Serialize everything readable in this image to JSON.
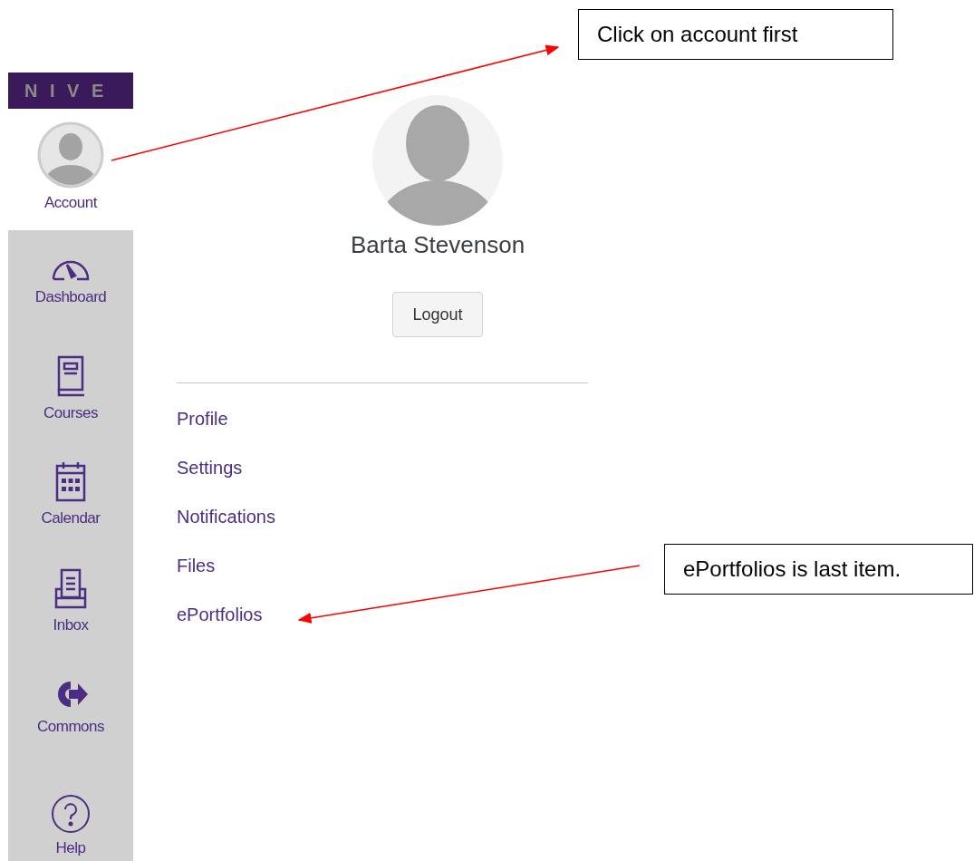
{
  "brand": {
    "text": "N I V E"
  },
  "sidebar": {
    "items": [
      {
        "label": "Account",
        "kind": "account",
        "selected": true
      },
      {
        "label": "Dashboard",
        "kind": "dashboard",
        "selected": false
      },
      {
        "label": "Courses",
        "kind": "courses",
        "selected": false
      },
      {
        "label": "Calendar",
        "kind": "calendar",
        "selected": false
      },
      {
        "label": "Inbox",
        "kind": "inbox",
        "selected": false
      },
      {
        "label": "Commons",
        "kind": "commons",
        "selected": false
      },
      {
        "label": "Help",
        "kind": "help",
        "selected": false
      }
    ]
  },
  "account": {
    "name": "Barta Stevenson",
    "logout": "Logout",
    "links": [
      "Profile",
      "Settings",
      "Notifications",
      "Files",
      "ePortfolios"
    ]
  },
  "callouts": [
    {
      "text": "Click on account first"
    },
    {
      "text": "ePortfolios is last item."
    }
  ]
}
